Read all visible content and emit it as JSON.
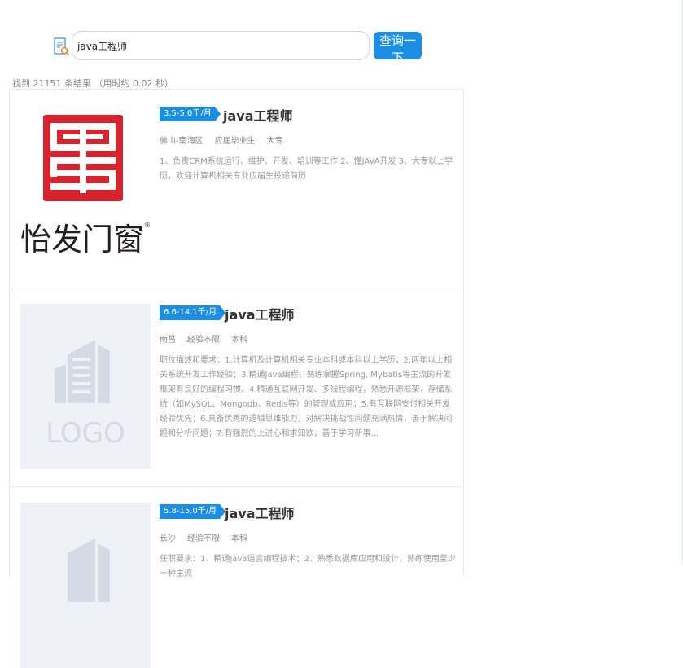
{
  "search": {
    "value": "java工程师",
    "button_label": "查询一下"
  },
  "results_summary": "找到 21151 条结果 （用时约 0.02 秒）",
  "jobs": [
    {
      "salary": "3.5-5.0千/月",
      "title": "java工程师",
      "location": "佛山-南海区",
      "experience": "应届毕业生",
      "education": "大专",
      "description": "1、负责CRM系统运行、维护、开发、培训等工作 2、懂JAVA开发 3、大专以上学历，欢迎计算机相关专业应届生投递简历",
      "logo_text": "怡发门窗",
      "logo_mark": "®"
    },
    {
      "salary": "6.6-14.1千/月",
      "title": "java工程师",
      "location": "南昌",
      "experience": "经验不限",
      "education": "本科",
      "description": "职位描述和要求：1.计算机及计算机相关专业本科或本科以上学历；2.两年以上相关系统开发工作经验；3.精通Java编程，熟练掌握Spring, Mybatis等主流的开发框架有良好的编程习惯。4.精通互联网开发、多线程编程，熟悉开源框架，存储系统（如MySQL、Mongodb、Redis等）的管理或应用；5.有互联网支付相关开发经验优先；6.具备优秀的逻辑思维能力，对解决挑战性问题充满热情，善于解决问题和分析问题；7.有强烈的上进心和求知欲，善于学习新事...",
      "logo_text": "LOGO"
    },
    {
      "salary": "5.8-15.0千/月",
      "title": "java工程师",
      "location": "长沙",
      "experience": "经验不限",
      "education": "本科",
      "description": "任职要求：1、精通Java语言编程技术；2、熟悉数据库应用和设计，熟练使用至少一种主流"
    }
  ],
  "colors": {
    "accent": "#1b8fe6",
    "logo_red": "#d8222d",
    "placeholder_bg": "#eef1f6"
  }
}
